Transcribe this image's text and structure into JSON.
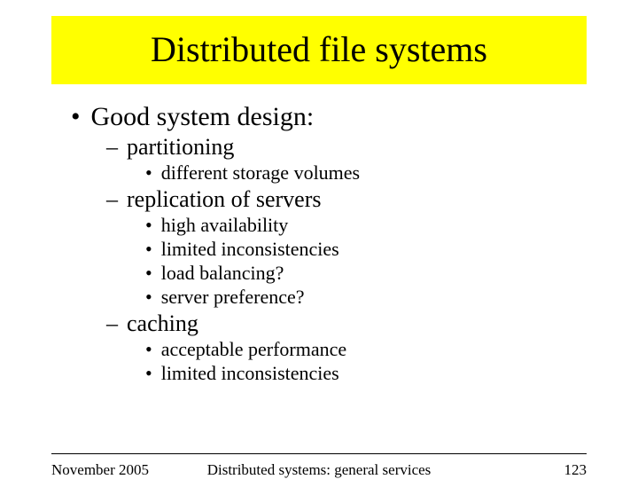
{
  "title": "Distributed file systems",
  "bullets": {
    "l1_0": "Good  system design:",
    "l2_0": "partitioning",
    "l3_0": "different storage volumes",
    "l2_1": "replication of servers",
    "l3_1": "high availability",
    "l3_2": "limited inconsistencies",
    "l3_3": "load balancing?",
    "l3_4": "server preference?",
    "l2_2": "caching",
    "l3_5": "acceptable performance",
    "l3_6": "limited inconsistencies"
  },
  "footer": {
    "left": "November 2005",
    "center": "Distributed systems: general services",
    "right": "123"
  }
}
